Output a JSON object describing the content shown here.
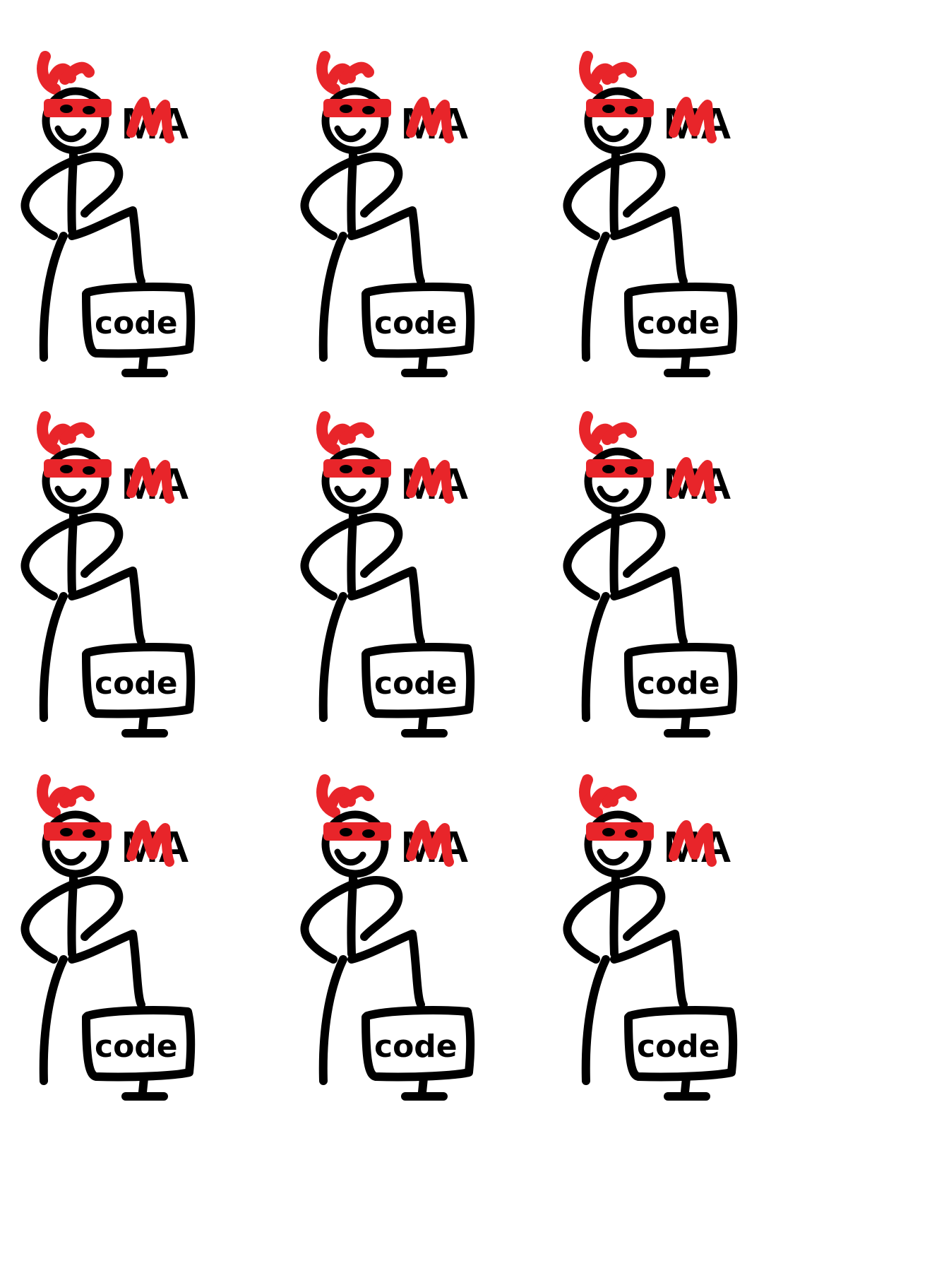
{
  "colors": {
    "ink": "#000000",
    "accent": "#e8252a",
    "background": "#ffffff"
  },
  "logo": {
    "badge_letters": "MA",
    "screen_word": "code",
    "icon": "ninja-coder-stick-figure-icon"
  },
  "tiles": [
    {
      "id": 1
    },
    {
      "id": 2
    },
    {
      "id": 3
    },
    {
      "id": 4
    },
    {
      "id": 5
    },
    {
      "id": 6
    },
    {
      "id": 7
    },
    {
      "id": 8
    },
    {
      "id": 9
    }
  ]
}
